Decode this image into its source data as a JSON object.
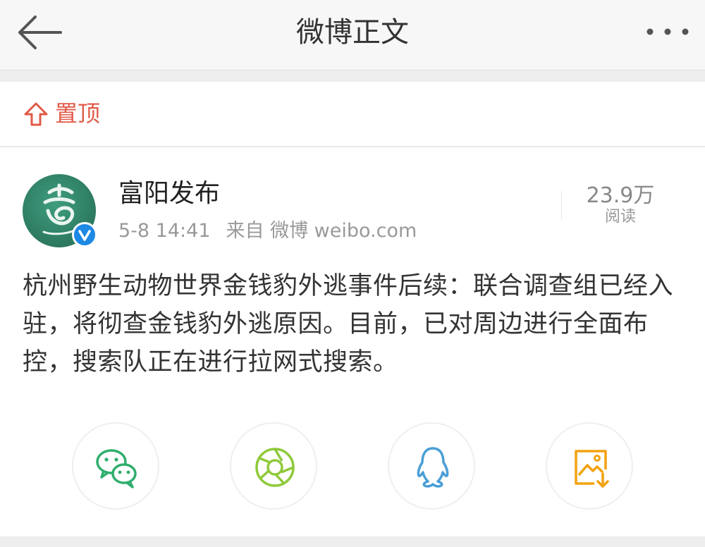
{
  "header": {
    "title": "微博正文"
  },
  "pinned": {
    "label": "置顶"
  },
  "post": {
    "author": "富阳发布",
    "time": "5-8 14:41",
    "source": "来自 微博 weibo.com",
    "read_count": "23.9万",
    "read_label": "阅读",
    "text": "杭州野生动物世界金钱豹外逃事件后续：联合调查组已经入驻，将彻查金钱豹外逃原因。目前，已对周边进行全面布控，搜索队正在进行拉网式搜索。"
  },
  "share": {
    "items": [
      {
        "icon": "wechat-icon"
      },
      {
        "icon": "moments-icon"
      },
      {
        "icon": "qq-icon"
      },
      {
        "icon": "save-image-icon"
      }
    ]
  },
  "colors": {
    "accent": "#e05a47",
    "verified": "#1e88e5",
    "wechat": "#2fae6d",
    "moments": "#8fc93a",
    "qq": "#4a9fd6",
    "save_image": "#f2a20f",
    "avatar_bg": "#2f7e64"
  }
}
